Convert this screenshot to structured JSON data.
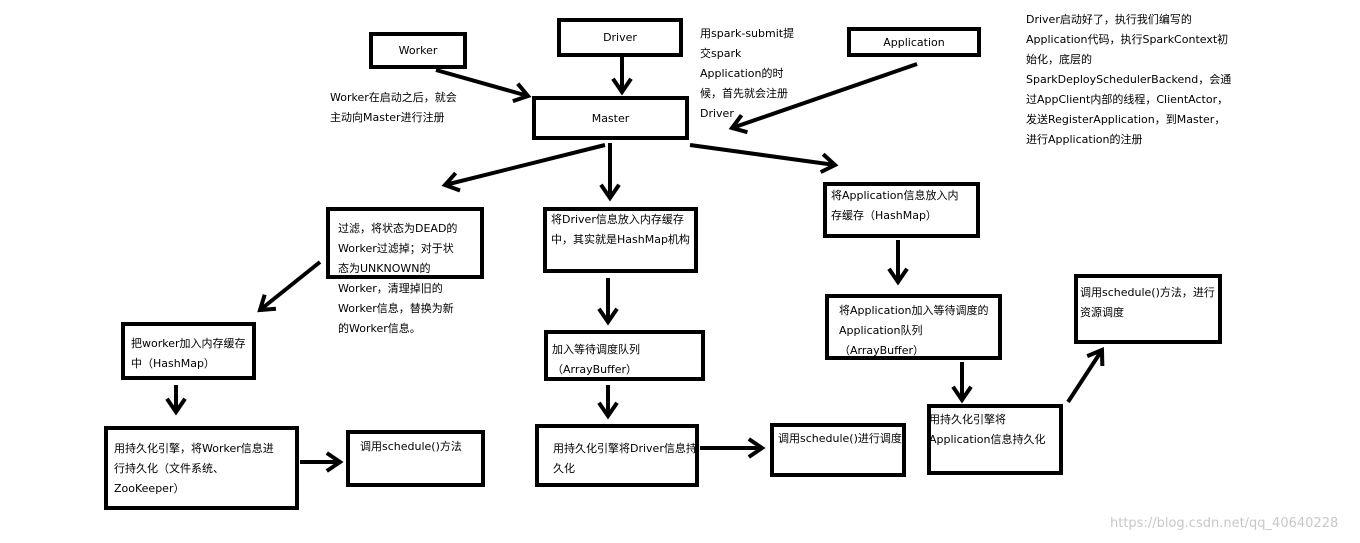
{
  "nodes": {
    "worker": "Worker",
    "driver": "Driver",
    "application": "Application",
    "master": "Master",
    "filter_workers": "过滤，将状态为DEAD的\nWorker过滤掉；对于状\n态为UNKNOWN的\nWorker，清理掉旧的\nWorker信息，替换为新\n的Worker信息。",
    "driver_to_memory": "将Driver信息放入内存缓存\n中，其实就是HashMap机构",
    "app_to_memory": "将Application信息放入内\n存缓存（HashMap）",
    "worker_to_memory": "把worker加入内存缓存\n中（HashMap）",
    "driver_wait_queue": "加入等待调度队列\n（ArrayBuffer）",
    "app_wait_queue": "将Application加入等待调度的\nApplication队列\n（ArrayBuffer）",
    "app_schedule": "调用schedule()方法，进行\n资源调度",
    "worker_persist": "用持久化引擎，将Worker信息进\n行持久化（文件系统、\nZooKeeper）",
    "worker_schedule": "调用schedule()方法",
    "driver_persist": "用持久化引擎将Driver信息持\n久化",
    "driver_schedule": "调用schedule()进行调度",
    "app_persist": "用持久化引擎将\nApplication信息持久化"
  },
  "notes": {
    "worker_note": "Worker在启动之后，就会\n主动向Master进行注册",
    "driver_note": "用spark-submit提\n交spark\nApplication的时\n候，首先就会注册\nDriver",
    "app_note": "Driver启动好了，执行我们编写的\nApplication代码，执行SparkContext初\n始化，底层的\nSparkDeploySchedulerBackend，会通\n过AppClient内部的线程，ClientActor，\n发送RegisterApplication，到Master，\n进行Application的注册"
  },
  "watermark": "https://blog.csdn.net/qq_40640228",
  "colors": {
    "stroke": "#000000",
    "watermark": "#c8c8c8"
  }
}
